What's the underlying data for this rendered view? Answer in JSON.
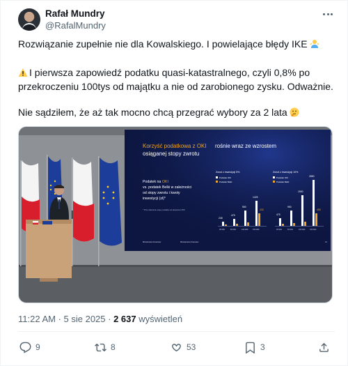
{
  "author": {
    "name": "Rafał Mundry",
    "handle": "@RafalMundry"
  },
  "tweet": {
    "line1": "Rozwiązanie zupełnie nie dla Kowalskiego. I powielające błędy IKE",
    "line2a": "I pierwsza zapowiedź podatku quasi-katastralnego, czyli 0,8% po",
    "line2b": "przekroczeniu 100tys od majątku a nie od zarobionego zysku. Odważnie.",
    "line3": "Nie sądziłem, że aż tak mocno chcą przegrać wybory za 2 lata"
  },
  "slide": {
    "title_highlight": "Korzyść podatkowa z OKI",
    "title_rest": "rośnie wraz ze wzrostem",
    "title_line2": "osiąganej stopy zwrotu",
    "left_text_1": "Podatek na",
    "left_text_highlight": "OKI",
    "left_text_2": "vs. podatek Belki w zależności",
    "left_text_3": "od stopy zwrotu i kwoty",
    "left_text_4": "inwestycji (zł)*",
    "footnote": "* Przy założeniu stopy podatku od aktywów 0,8%",
    "chart1_title": "Zwrot z inwestycji 5%",
    "chart2_title": "Zwrot z inwestycji 10%",
    "legend_oki": "Podatek OKI",
    "legend_belka": "Podatek Belki",
    "chart1_values": [
      "238",
      "475",
      "950",
      "1425",
      "433"
    ],
    "chart2_values": [
      "475",
      "950",
      "1900",
      "2850",
      "455"
    ],
    "x_labels": [
      "25 000",
      "50 000",
      "100 000",
      "150 000"
    ],
    "footer_left": "Ministerstwo Finansów",
    "footer_mid": "Ministerstwo Finansów",
    "page_num": "12"
  },
  "meta": {
    "time": "11:22 AM · 5 sie 2025 ·",
    "views_count": "2 637",
    "views_label": "wyświetleń"
  },
  "actions": {
    "replies": "9",
    "reposts": "8",
    "likes": "53",
    "bookmarks": "3"
  },
  "colors": {
    "accent": "#1d9bf0",
    "slide_bg": "#0d1640",
    "slide_highlight": "#f0a524"
  }
}
